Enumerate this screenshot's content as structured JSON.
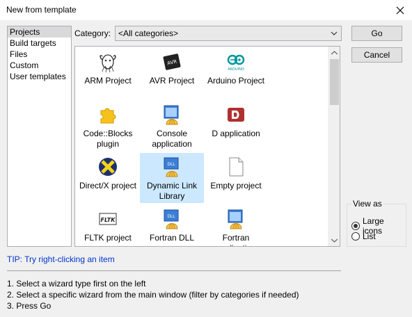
{
  "window": {
    "title": "New from template"
  },
  "categories_list": [
    "Projects",
    "Build targets",
    "Files",
    "Custom",
    "User templates"
  ],
  "category": {
    "label": "Category:",
    "selected": "<All categories>"
  },
  "templates": [
    {
      "label": "ARM Project",
      "icon": "gnu-gnu-icon"
    },
    {
      "label": "AVR Project",
      "icon": "avr-chip-icon"
    },
    {
      "label": "Arduino Project",
      "icon": "arduino-icon"
    },
    {
      "label": "Code::Blocks plugin",
      "icon": "puzzle-piece-icon"
    },
    {
      "label": "Console application",
      "icon": "console-shell-icon"
    },
    {
      "label": "D application",
      "icon": "d-language-icon"
    },
    {
      "label": "Direct/X project",
      "icon": "directx-icon"
    },
    {
      "label": "Dynamic Link Library",
      "icon": "dll-shell-icon"
    },
    {
      "label": "Empty project",
      "icon": "blank-page-icon"
    },
    {
      "label": "FLTK project",
      "icon": "fltk-icon"
    },
    {
      "label": "Fortran DLL",
      "icon": "dll-shell-icon"
    },
    {
      "label": "Fortran application",
      "icon": "application-shell-icon"
    }
  ],
  "buttons": {
    "go": "Go",
    "cancel": "Cancel"
  },
  "view_as": {
    "title": "View as",
    "large_icons": "Large icons",
    "list": "List",
    "selected": "large_icons"
  },
  "tip": "TIP: Try right-clicking an item",
  "instructions": [
    "1. Select a wizard type first on the left",
    "2. Select a specific wizard from the main window (filter by categories if needed)",
    "3. Press Go"
  ],
  "colors": {
    "selection": "#cce8ff",
    "tip": "#0033cc"
  }
}
